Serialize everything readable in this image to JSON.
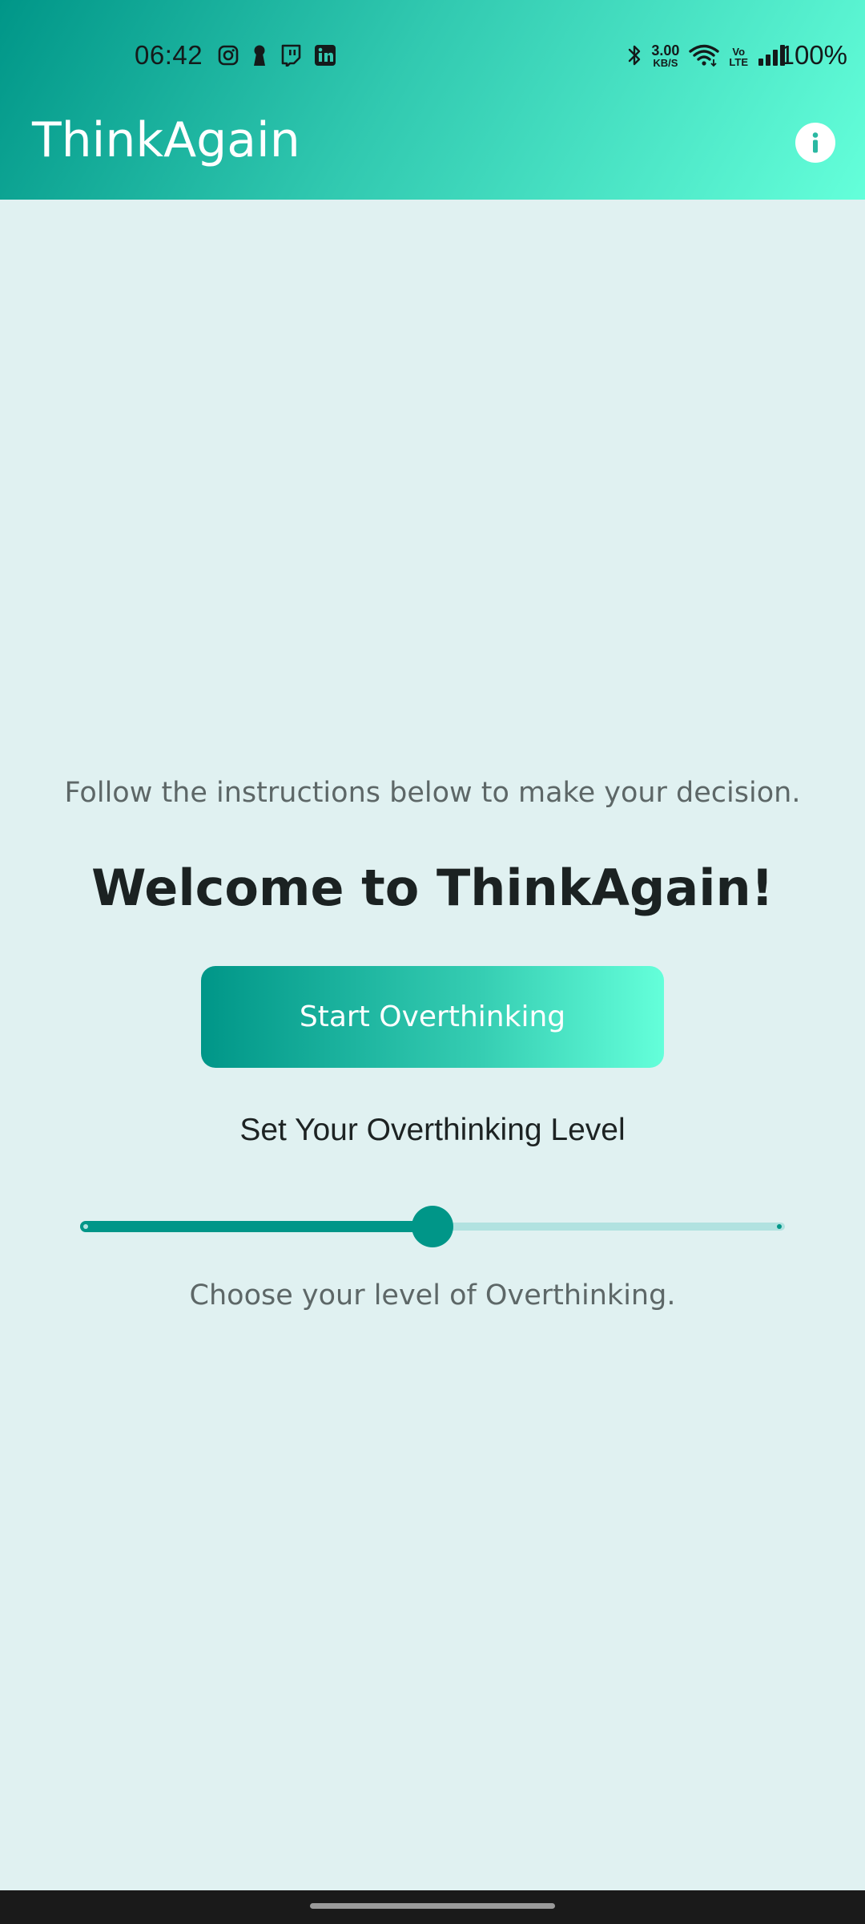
{
  "status_bar": {
    "time": "06:42",
    "net_speed_value": "3.00",
    "net_speed_unit": "KB/S",
    "volte_top": "Vo",
    "volte_bottom": "LTE",
    "battery": "100%",
    "icons_left": [
      "instagram-icon",
      "keyhole-icon",
      "twitch-icon",
      "linkedin-icon"
    ],
    "icons_right": [
      "bluetooth-icon",
      "wifi-icon",
      "signal-icon"
    ]
  },
  "app_bar": {
    "title": "ThinkAgain",
    "info_icon": "info-icon",
    "gradient": [
      "#009688",
      "#64ffda"
    ]
  },
  "main": {
    "instruction": "Follow the instructions below to make your decision.",
    "welcome": "Welcome to ThinkAgain!",
    "start_button_label": "Start Overthinking",
    "level_heading": "Set Your Overthinking Level",
    "slider": {
      "value": 0.5,
      "min": 0,
      "max": 1
    },
    "level_caption": "Choose your level of Overthinking."
  },
  "colors": {
    "accent": "#009688",
    "accent_light": "#64ffda",
    "background": "#e0f1f1",
    "track_inactive": "#b1e2e0"
  }
}
